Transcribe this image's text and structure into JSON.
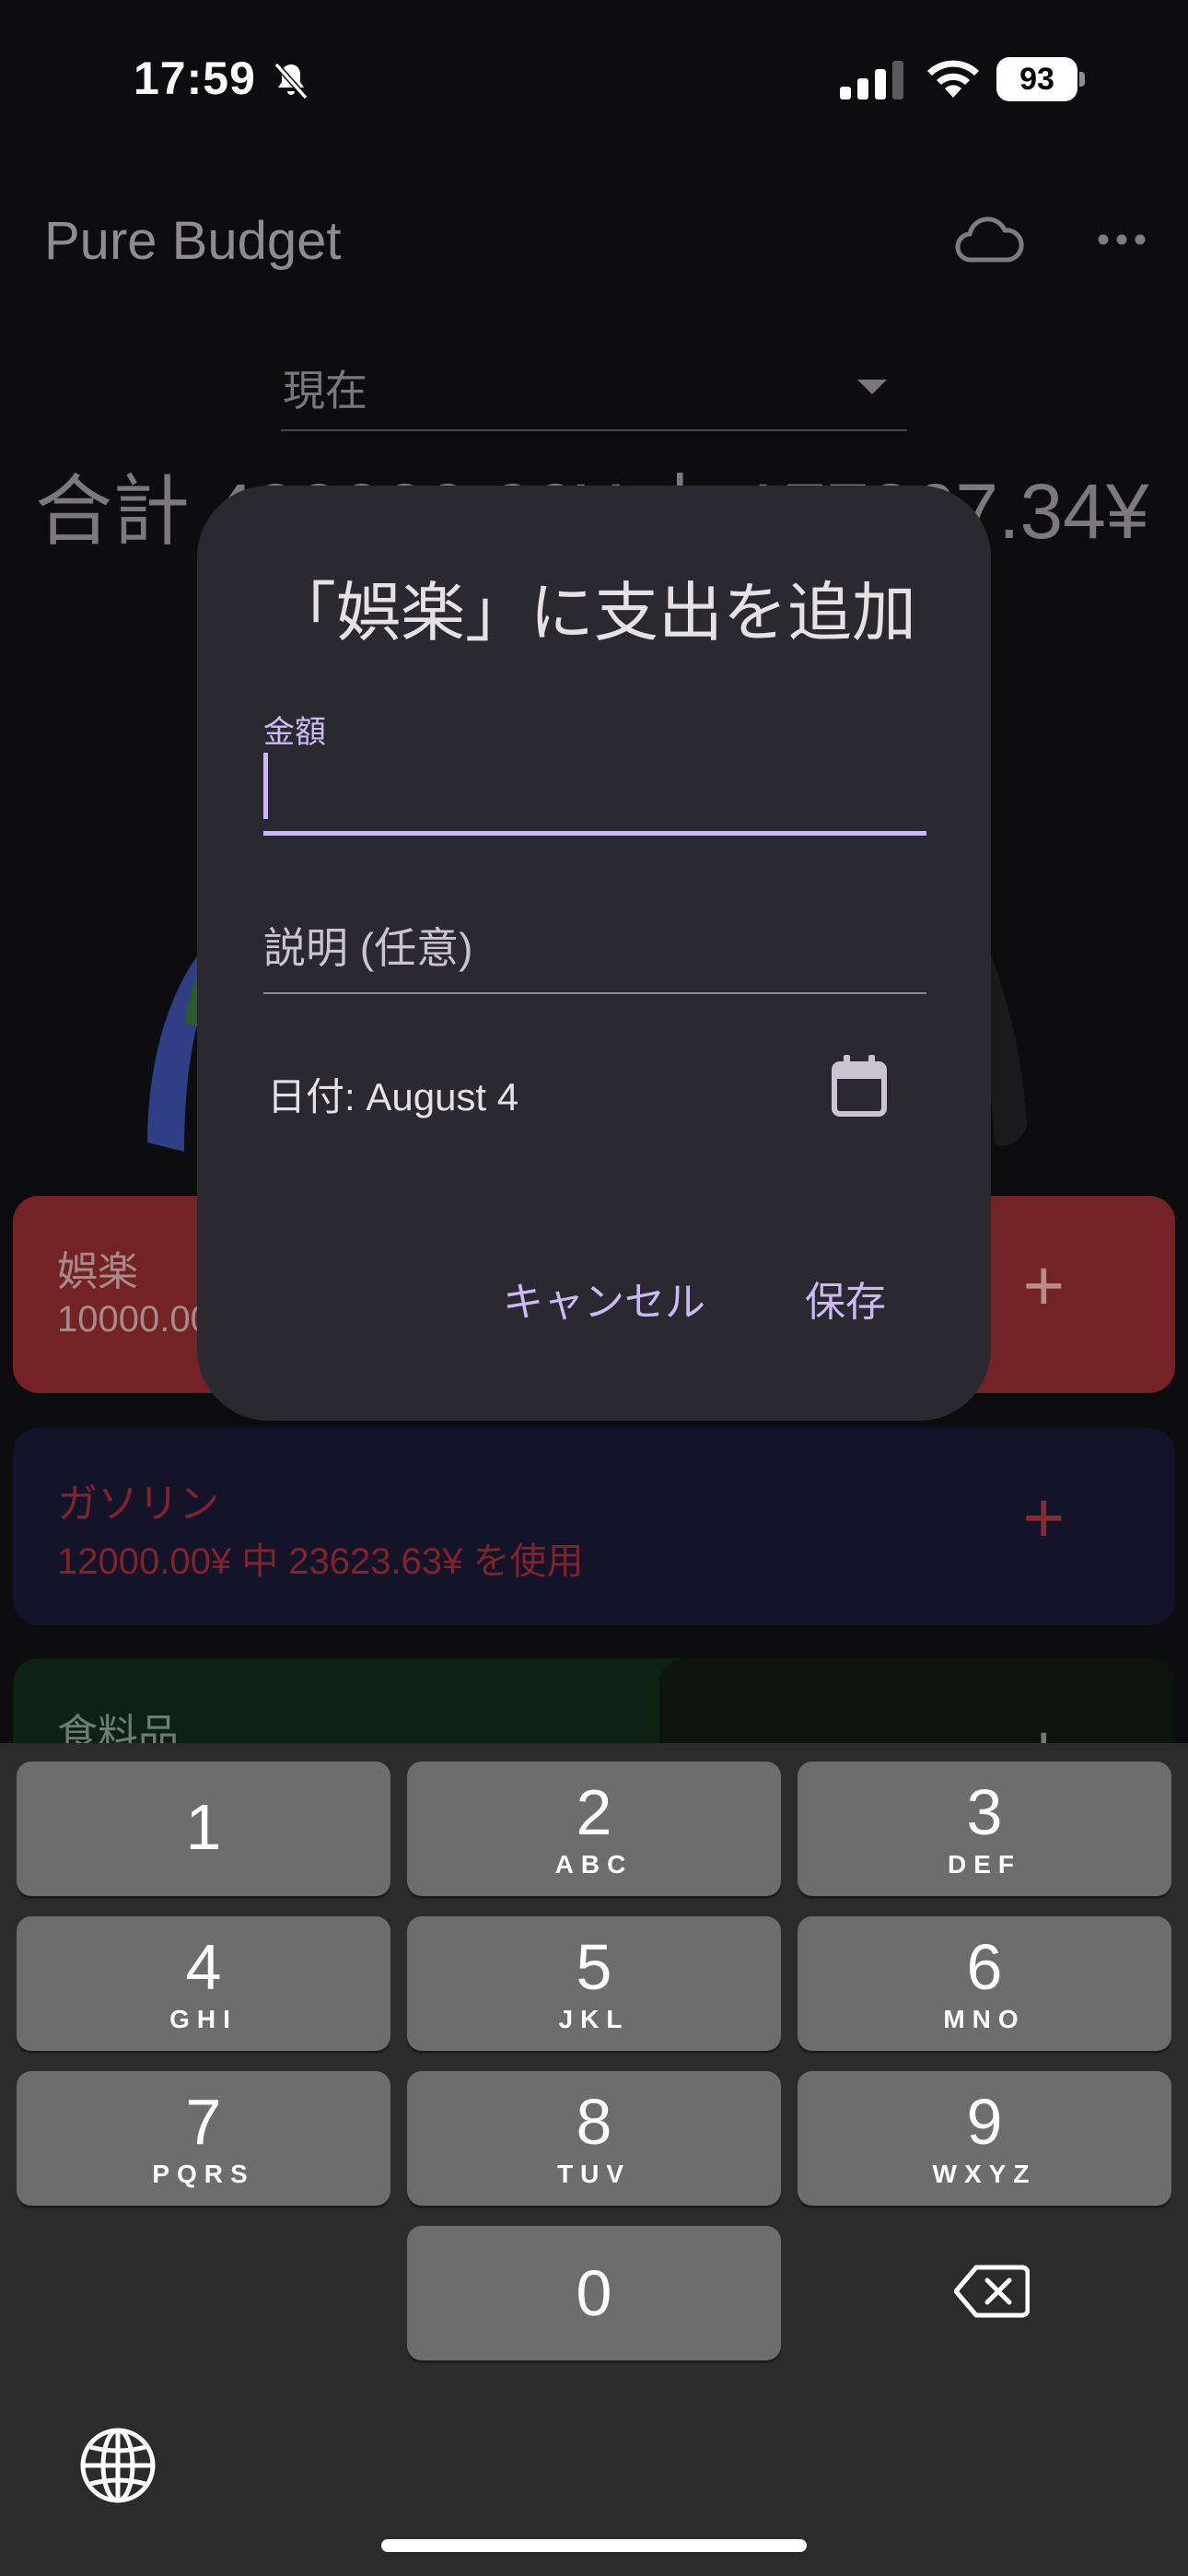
{
  "status_bar": {
    "time": "17:59",
    "battery": "93"
  },
  "app_bar": {
    "title": "Pure Budget"
  },
  "period_selector": {
    "value": "現在"
  },
  "summary": {
    "text": "合計 400000.00¥ 中 177367.34¥"
  },
  "categories": [
    {
      "name": "娯楽",
      "sub": "10000.00¥",
      "color": "#732325"
    },
    {
      "name": "ガソリン",
      "sub": "12000.00¥ 中 23623.63¥ を使用",
      "color": "#131329"
    },
    {
      "name": "食料品",
      "sub": "",
      "color": "#0e2211"
    }
  ],
  "dialog": {
    "title": "「娯楽」に支出を追加",
    "amount_label": "金額",
    "amount_value": "",
    "description_placeholder": "説明 (任意)",
    "date_text": "日付: August 4",
    "cancel_label": "キャンセル",
    "save_label": "保存"
  },
  "keyboard": {
    "keys": [
      {
        "num": "1",
        "letters": ""
      },
      {
        "num": "2",
        "letters": "ABC"
      },
      {
        "num": "3",
        "letters": "DEF"
      },
      {
        "num": "4",
        "letters": "GHI"
      },
      {
        "num": "5",
        "letters": "JKL"
      },
      {
        "num": "6",
        "letters": "MNO"
      },
      {
        "num": "7",
        "letters": "PQRS"
      },
      {
        "num": "8",
        "letters": "TUV"
      },
      {
        "num": "9",
        "letters": "WXYZ"
      },
      {
        "num": "0",
        "letters": ""
      }
    ]
  },
  "icons": {
    "bell": "bell-slash-icon",
    "signal": "cellular-signal-icon",
    "wifi": "wifi-icon",
    "cloud": "cloud-icon",
    "more": "more-horizontal-icon",
    "calendar": "calendar-icon",
    "delete": "backspace-icon",
    "globe": "globe-icon"
  }
}
